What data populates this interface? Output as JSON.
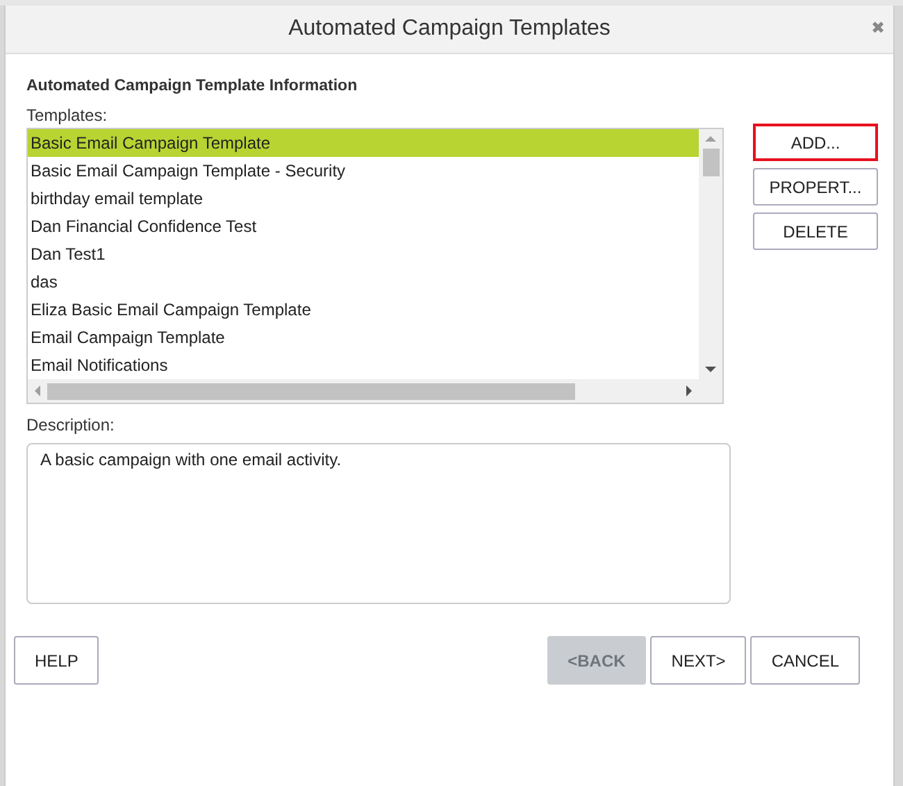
{
  "dialog": {
    "title": "Automated Campaign Templates",
    "close_icon": "✖"
  },
  "section_title": "Automated Campaign Template Information",
  "templates": {
    "label": "Templates:",
    "items": [
      {
        "name": "Basic Email Campaign Template",
        "selected": true
      },
      {
        "name": "Basic Email Campaign Template - Security",
        "selected": false
      },
      {
        "name": "birthday email template",
        "selected": false
      },
      {
        "name": "Dan Financial Confidence Test",
        "selected": false
      },
      {
        "name": "Dan Test1",
        "selected": false
      },
      {
        "name": "das",
        "selected": false
      },
      {
        "name": "Eliza Basic Email Campaign Template",
        "selected": false
      },
      {
        "name": "Email Campaign Template",
        "selected": false
      },
      {
        "name": "Email Notifications",
        "selected": false
      }
    ]
  },
  "side_buttons": [
    {
      "label": "ADD...",
      "highlighted": true
    },
    {
      "label": "PROPERT...",
      "highlighted": false
    },
    {
      "label": "DELETE",
      "highlighted": false
    }
  ],
  "description": {
    "label": "Description:",
    "value": "A basic campaign with one email activity."
  },
  "footer": {
    "left": [
      {
        "label": "HELP",
        "disabled": false
      }
    ],
    "right": [
      {
        "label": "<BACK",
        "disabled": true
      },
      {
        "label": "NEXT>",
        "disabled": false
      },
      {
        "label": "CANCEL",
        "disabled": false
      }
    ]
  }
}
